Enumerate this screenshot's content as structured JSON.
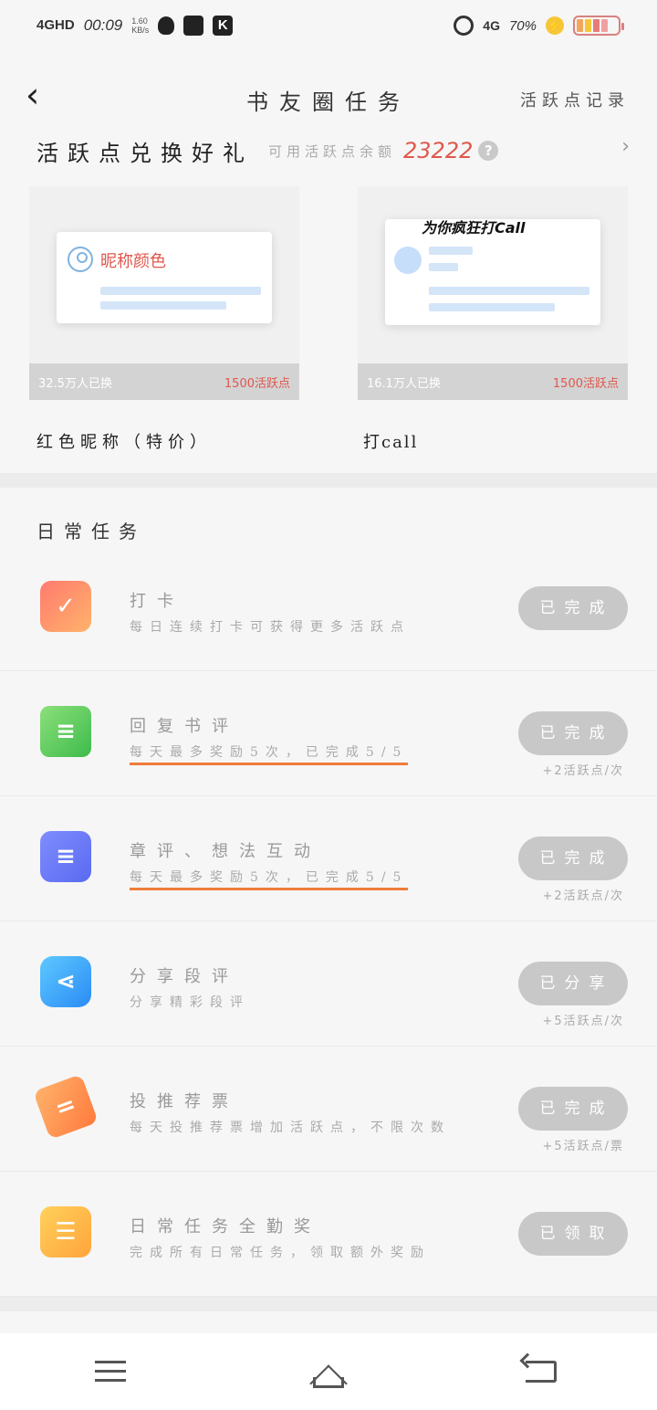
{
  "status_bar": {
    "network": "4GHD",
    "time": "00:09",
    "speed": "1.60",
    "speed_unit": "KB/s",
    "network_right": "4G",
    "battery_percent": "70%",
    "colors": {
      "battery_outline": "#d98080",
      "bolt": "#f7c637"
    },
    "icons": [
      "qq-icon",
      "calendar-icon",
      "k-app-icon",
      "alarm-icon",
      "charging-icon",
      "battery-icon"
    ]
  },
  "header": {
    "title": "书友圈任务",
    "right_link": "活跃点记录",
    "back_icon": "chevron-left-icon"
  },
  "exchange": {
    "title": "活跃点兑换好礼",
    "balance_label": "可用活跃点余额",
    "balance_value": "23222",
    "help_symbol": "?",
    "arrow_symbol": "›",
    "cards": [
      {
        "preview_text": "昵称颜色",
        "exchanged": "32.5万人已换",
        "cost": "1500活跃点",
        "name": "红色昵称（特价）"
      },
      {
        "preview_text": "为你疯狂打Call",
        "exchanged": "16.1万人已换",
        "cost": "1500活跃点",
        "name": "打call"
      }
    ]
  },
  "daily": {
    "title": "日常任务",
    "tasks": [
      {
        "icon": "calendar-check-icon",
        "name": "打卡",
        "desc": "每日连续打卡可获得更多活跃点",
        "progress_bar": false,
        "button": "已完成",
        "bonus": ""
      },
      {
        "icon": "chat-bubble-icon",
        "name": "回复书评",
        "desc": "每天最多奖励5次，已完成5/5",
        "progress_bar": true,
        "button": "已完成",
        "bonus": "+2活跃点/次"
      },
      {
        "icon": "document-icon",
        "name": "章评、想法互动",
        "desc": "每天最多奖励5次，已完成5/5",
        "progress_bar": true,
        "button": "已完成",
        "bonus": "+2活跃点/次"
      },
      {
        "icon": "share-icon",
        "name": "分享段评",
        "desc": "分享精彩段评",
        "progress_bar": false,
        "button": "已分享",
        "bonus": "+5活跃点/次"
      },
      {
        "icon": "ticket-icon",
        "name": "投推荐票",
        "desc": "每天投推荐票增加活跃点，不限次数",
        "progress_bar": false,
        "button": "已完成",
        "bonus": "+5活跃点/票"
      },
      {
        "icon": "list-icon",
        "name": "日常任务全勤奖",
        "desc": "完成所有日常任务，领取额外奖励",
        "progress_bar": false,
        "button": "已领取",
        "bonus": ""
      }
    ]
  },
  "colors": {
    "accent_red": "#e0574c",
    "progress_underline": "#ef7d3a",
    "button_disabled": "#c8c8c8"
  },
  "bottom_nav": [
    "menu-icon",
    "home-icon",
    "back-icon"
  ]
}
